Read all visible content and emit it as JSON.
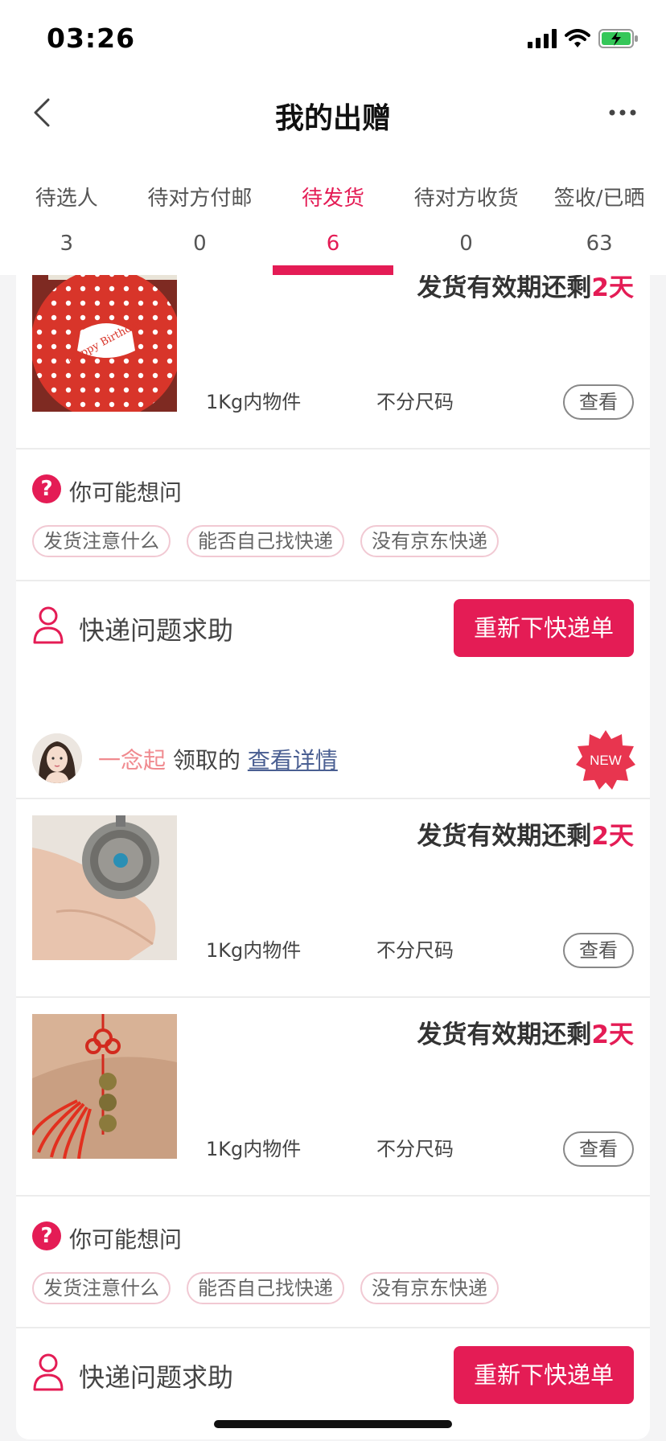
{
  "status_bar": {
    "time": "03:26"
  },
  "nav": {
    "title": "我的出赠"
  },
  "tabs": [
    {
      "label": "待选人",
      "count": "3"
    },
    {
      "label": "待对方付邮",
      "count": "0"
    },
    {
      "label": "待发货",
      "count": "6",
      "active": true
    },
    {
      "label": "待对方收货",
      "count": "0"
    },
    {
      "label": "签收/已晒",
      "count": "63"
    }
  ],
  "card1": {
    "item": {
      "deadline_prefix": "发货有效期还剩",
      "deadline_days": "2天",
      "weight": "1Kg内物件",
      "size": "不分尺码",
      "view_label": "查看",
      "image_text": "Happy Birthday"
    },
    "faq": {
      "title": "你可能想问",
      "icon": "?",
      "chips": [
        "发货注意什么",
        "能否自己找快递",
        "没有京东快递"
      ]
    },
    "help": {
      "label": "快递问题求助",
      "button": "重新下快递单"
    }
  },
  "card2": {
    "receiver": {
      "name": "一念起",
      "action": " 领取的 ",
      "link": "查看详情",
      "badge": "NEW"
    },
    "items": [
      {
        "deadline_prefix": "发货有效期还剩",
        "deadline_days": "2天",
        "weight": "1Kg内物件",
        "size": "不分尺码",
        "view_label": "查看"
      },
      {
        "deadline_prefix": "发货有效期还剩",
        "deadline_days": "2天",
        "weight": "1Kg内物件",
        "size": "不分尺码",
        "view_label": "查看"
      }
    ],
    "faq": {
      "title": "你可能想问",
      "icon": "?",
      "chips": [
        "发货注意什么",
        "能否自己找快递",
        "没有京东快递"
      ]
    },
    "help": {
      "label": "快递问题求助",
      "button": "重新下快递单"
    }
  },
  "colors": {
    "accent": "#e41c55",
    "name": "#f08a8f",
    "link": "#4a5f92"
  }
}
